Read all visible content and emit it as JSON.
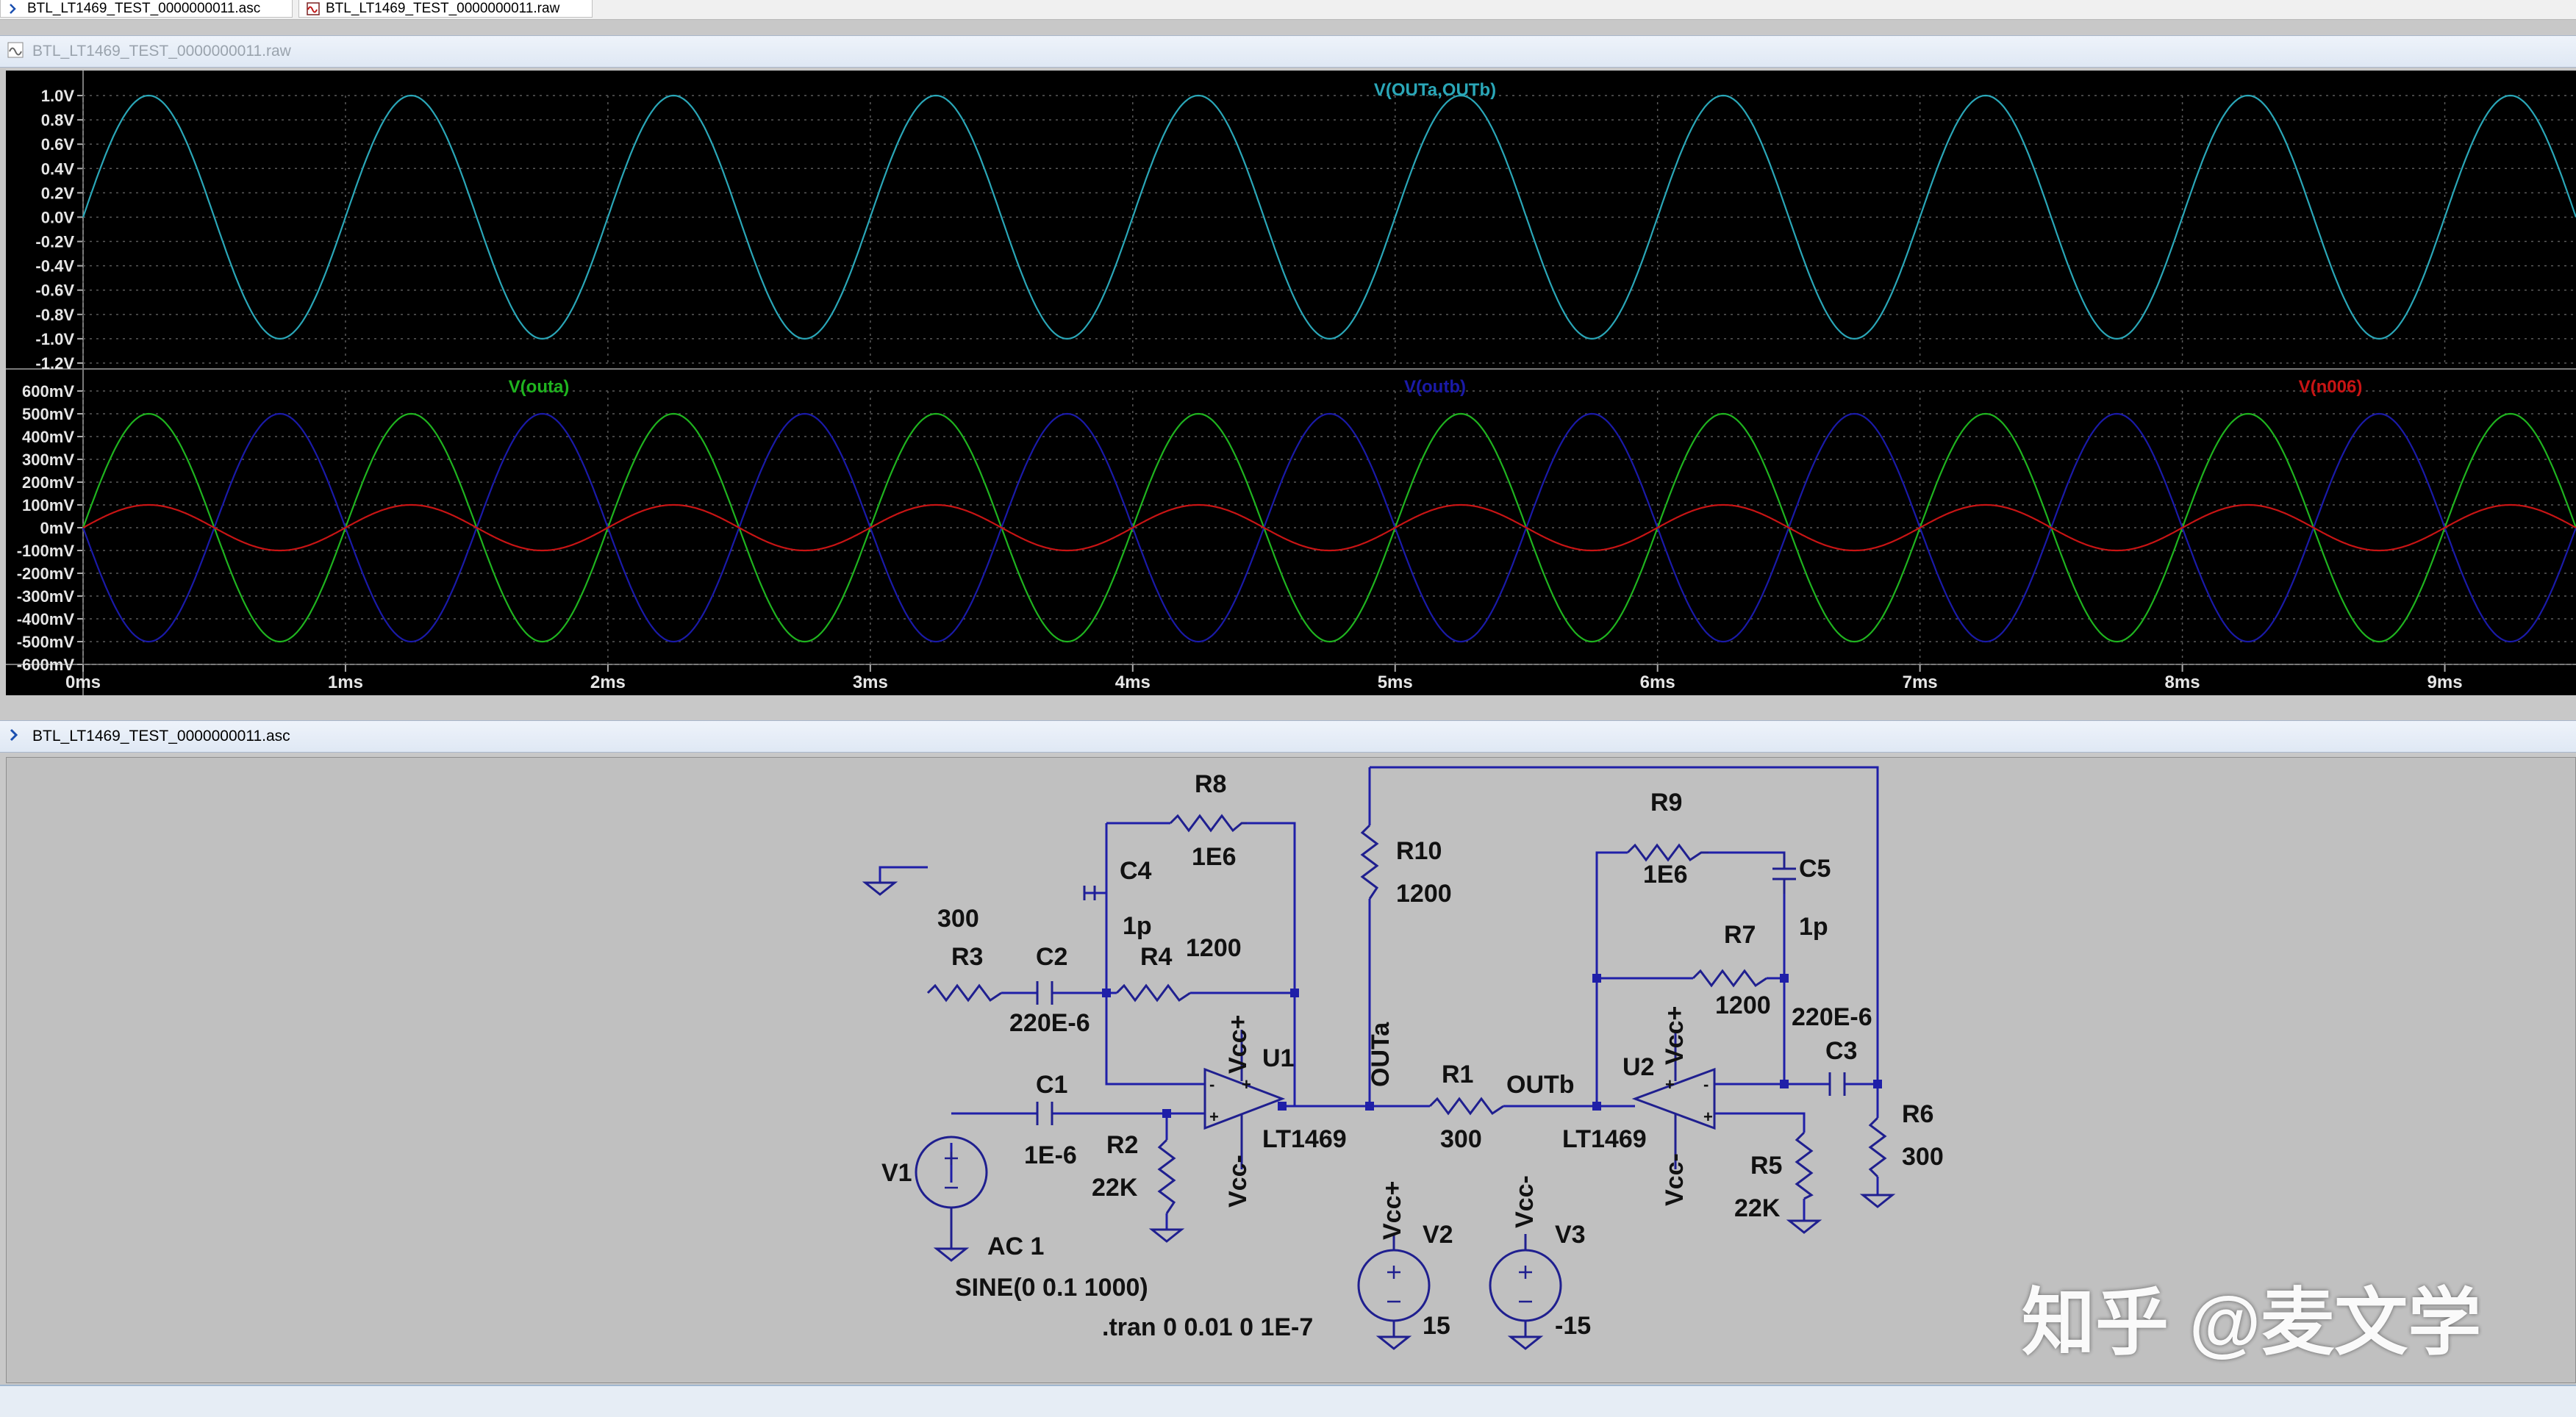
{
  "tabs": [
    {
      "label": "BTL_LT1469_TEST_0000000011.asc",
      "icon": "schematic-icon"
    },
    {
      "label": "BTL_LT1469_TEST_0000000011.raw",
      "icon": "waveform-icon"
    }
  ],
  "waveform_window": {
    "title": "BTL_LT1469_TEST_0000000011.raw",
    "icon": "waveform-icon"
  },
  "schematic_window": {
    "title": "BTL_LT1469_TEST_0000000011.asc",
    "icon": "schematic-icon"
  },
  "colors": {
    "trace_diff": "#2aa7b8",
    "trace_outa": "#1fb41f",
    "trace_outb": "#1a1aa8",
    "trace_n006": "#c81414",
    "wire": "#1f1fa8",
    "component": "#1f1f8f",
    "label": "#111111"
  },
  "chart_data": [
    {
      "type": "line",
      "title": "V(OUTa,OUTb)",
      "x_unit": "ms",
      "xlim": [
        0,
        9.5
      ],
      "ylim": [
        -1.2,
        1.0
      ],
      "y_ticks": [
        "1.0V",
        "0.8V",
        "0.6V",
        "0.4V",
        "0.2V",
        "0.0V",
        "-0.2V",
        "-0.4V",
        "-0.6V",
        "-0.8V",
        "-1.0V",
        "-1.2V"
      ],
      "series": [
        {
          "name": "V(OUTa,OUTb)",
          "waveform": "sine",
          "amplitude": 1.0,
          "frequency_hz": 1000,
          "phase": "sin",
          "offset": 0
        }
      ]
    },
    {
      "type": "line",
      "x_unit": "ms",
      "xlim": [
        0,
        9.5
      ],
      "ylim": [
        -600,
        600
      ],
      "y_ticks": [
        "600mV",
        "500mV",
        "400mV",
        "300mV",
        "200mV",
        "100mV",
        "0mV",
        "-100mV",
        "-200mV",
        "-300mV",
        "-400mV",
        "-500mV",
        "-600mV"
      ],
      "x_ticks": [
        "0ms",
        "1ms",
        "2ms",
        "3ms",
        "4ms",
        "5ms",
        "6ms",
        "7ms",
        "8ms",
        "9ms"
      ],
      "series": [
        {
          "name": "V(outa)",
          "waveform": "sine",
          "amplitude": 500,
          "frequency_hz": 1000,
          "phase": "sin"
        },
        {
          "name": "V(outb)",
          "waveform": "sine",
          "amplitude": -500,
          "frequency_hz": 1000,
          "phase": "sin"
        },
        {
          "name": "V(n006)",
          "waveform": "sine",
          "amplitude": 100,
          "frequency_hz": 1000,
          "phase": "sin"
        }
      ]
    }
  ],
  "schematic": {
    "labels": {
      "r8": "R8",
      "r8v": "1E6",
      "c4": "C4",
      "c4v": "1p",
      "r10": "R10",
      "r10v": "1200",
      "r9": "R9",
      "r9v": "1E6",
      "c5": "C5",
      "c5v": "1p",
      "r3v": "300",
      "r3": "R3",
      "c2": "C2",
      "c2v": "220E-6",
      "r4": "R4",
      "r4v": "1200",
      "vccp1": "Vcc+",
      "u1": "U1",
      "lt1": "LT1469",
      "vccm1": "Vcc-",
      "outa": "OUTa",
      "r1": "R1",
      "r1v": "300",
      "outb": "OUTb",
      "u2": "U2",
      "lt2": "LT1469",
      "vccp2": "Vcc+",
      "vccm2": "Vcc-",
      "r7": "R7",
      "r7v": "1200",
      "c3v": "220E-6",
      "c3": "C3",
      "r6": "R6",
      "r6v": "300",
      "c1": "C1",
      "c1v": "1E-6",
      "r2": "R2",
      "r2v": "22K",
      "v1": "V1",
      "ac": "AC 1",
      "sine": "SINE(0 0.1 1000)",
      "tran": ".tran 0 0.01 0 1E-7",
      "vccv2": "Vcc+",
      "v2": "V2",
      "v2v": "15",
      "vccv3": "Vcc-",
      "v3": "V3",
      "v3v": "-15",
      "r5": "R5",
      "r5v": "22K"
    }
  },
  "watermark": "知乎 @麦文学"
}
